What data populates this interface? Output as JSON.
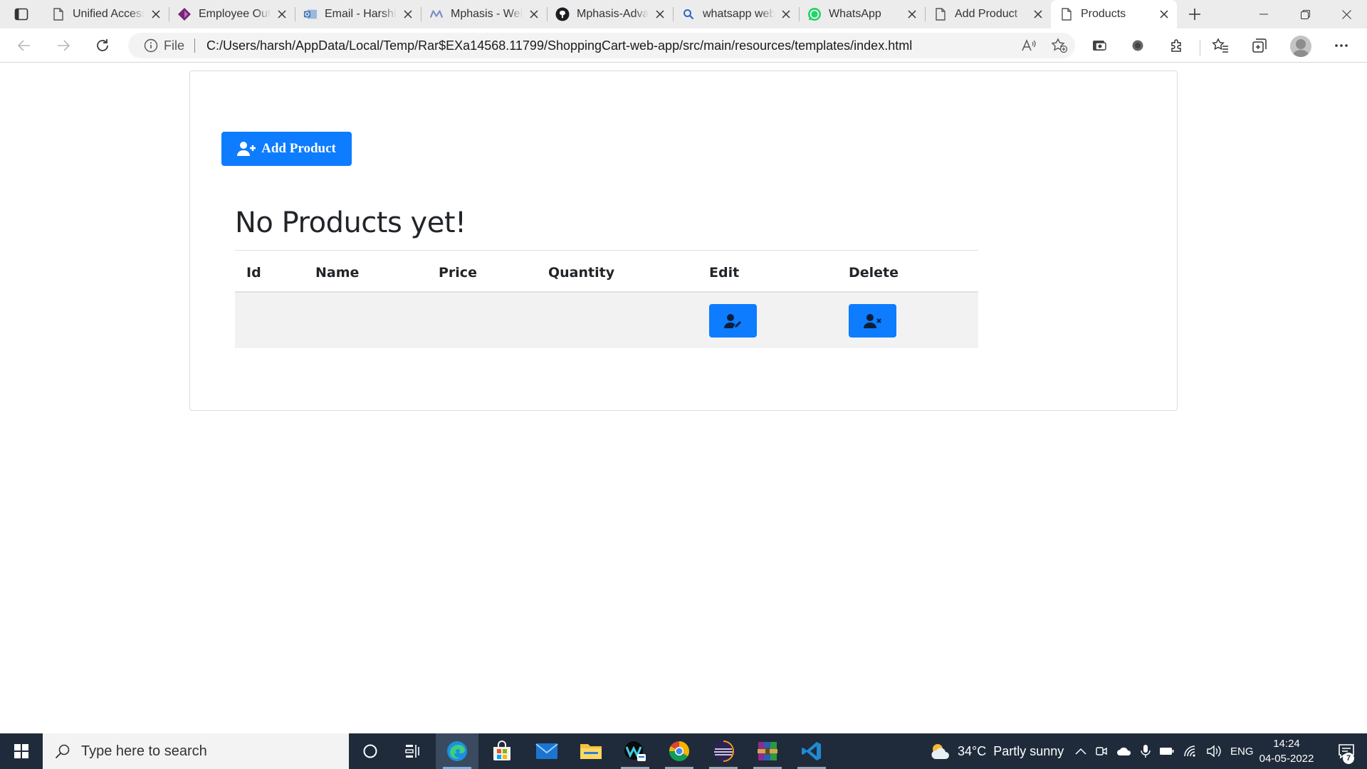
{
  "browser": {
    "tabs": [
      {
        "title": "Unified Access",
        "icon": "page-icon"
      },
      {
        "title": "Employee Out",
        "icon": "powerapps-icon"
      },
      {
        "title": "Email - Harshit",
        "icon": "outlook-icon"
      },
      {
        "title": "Mphasis - Wel",
        "icon": "mphasis-icon"
      },
      {
        "title": "Mphasis-Adva",
        "icon": "github-icon"
      },
      {
        "title": "whatsapp web",
        "icon": "search-icon"
      },
      {
        "title": "WhatsApp",
        "icon": "whatsapp-icon"
      },
      {
        "title": "Add Product",
        "icon": "page-icon"
      },
      {
        "title": "Products",
        "icon": "page-icon"
      }
    ],
    "active_tab": "Products",
    "address": {
      "scheme_label": "File",
      "url": "C:/Users/harsh/AppData/Local/Temp/Rar$EXa14568.11799/ShoppingCart-web-app/src/main/resources/templates/index.html"
    }
  },
  "page": {
    "add_button_label": "Add Product",
    "heading": "No Products yet!",
    "table": {
      "columns": [
        "Id",
        "Name",
        "Price",
        "Quantity",
        "Edit",
        "Delete"
      ],
      "rows": [
        {
          "id": "",
          "name": "",
          "price": "",
          "quantity": "",
          "edit": "edit-user-button",
          "delete": "delete-user-button"
        }
      ]
    },
    "accent_color": "#0d7cff"
  },
  "taskbar": {
    "search_placeholder": "Type here to search",
    "weather": {
      "temp": "34°C",
      "condition": "Partly sunny"
    },
    "language": "ENG",
    "time": "14:24",
    "date": "04-05-2022",
    "notification_count": "7"
  }
}
